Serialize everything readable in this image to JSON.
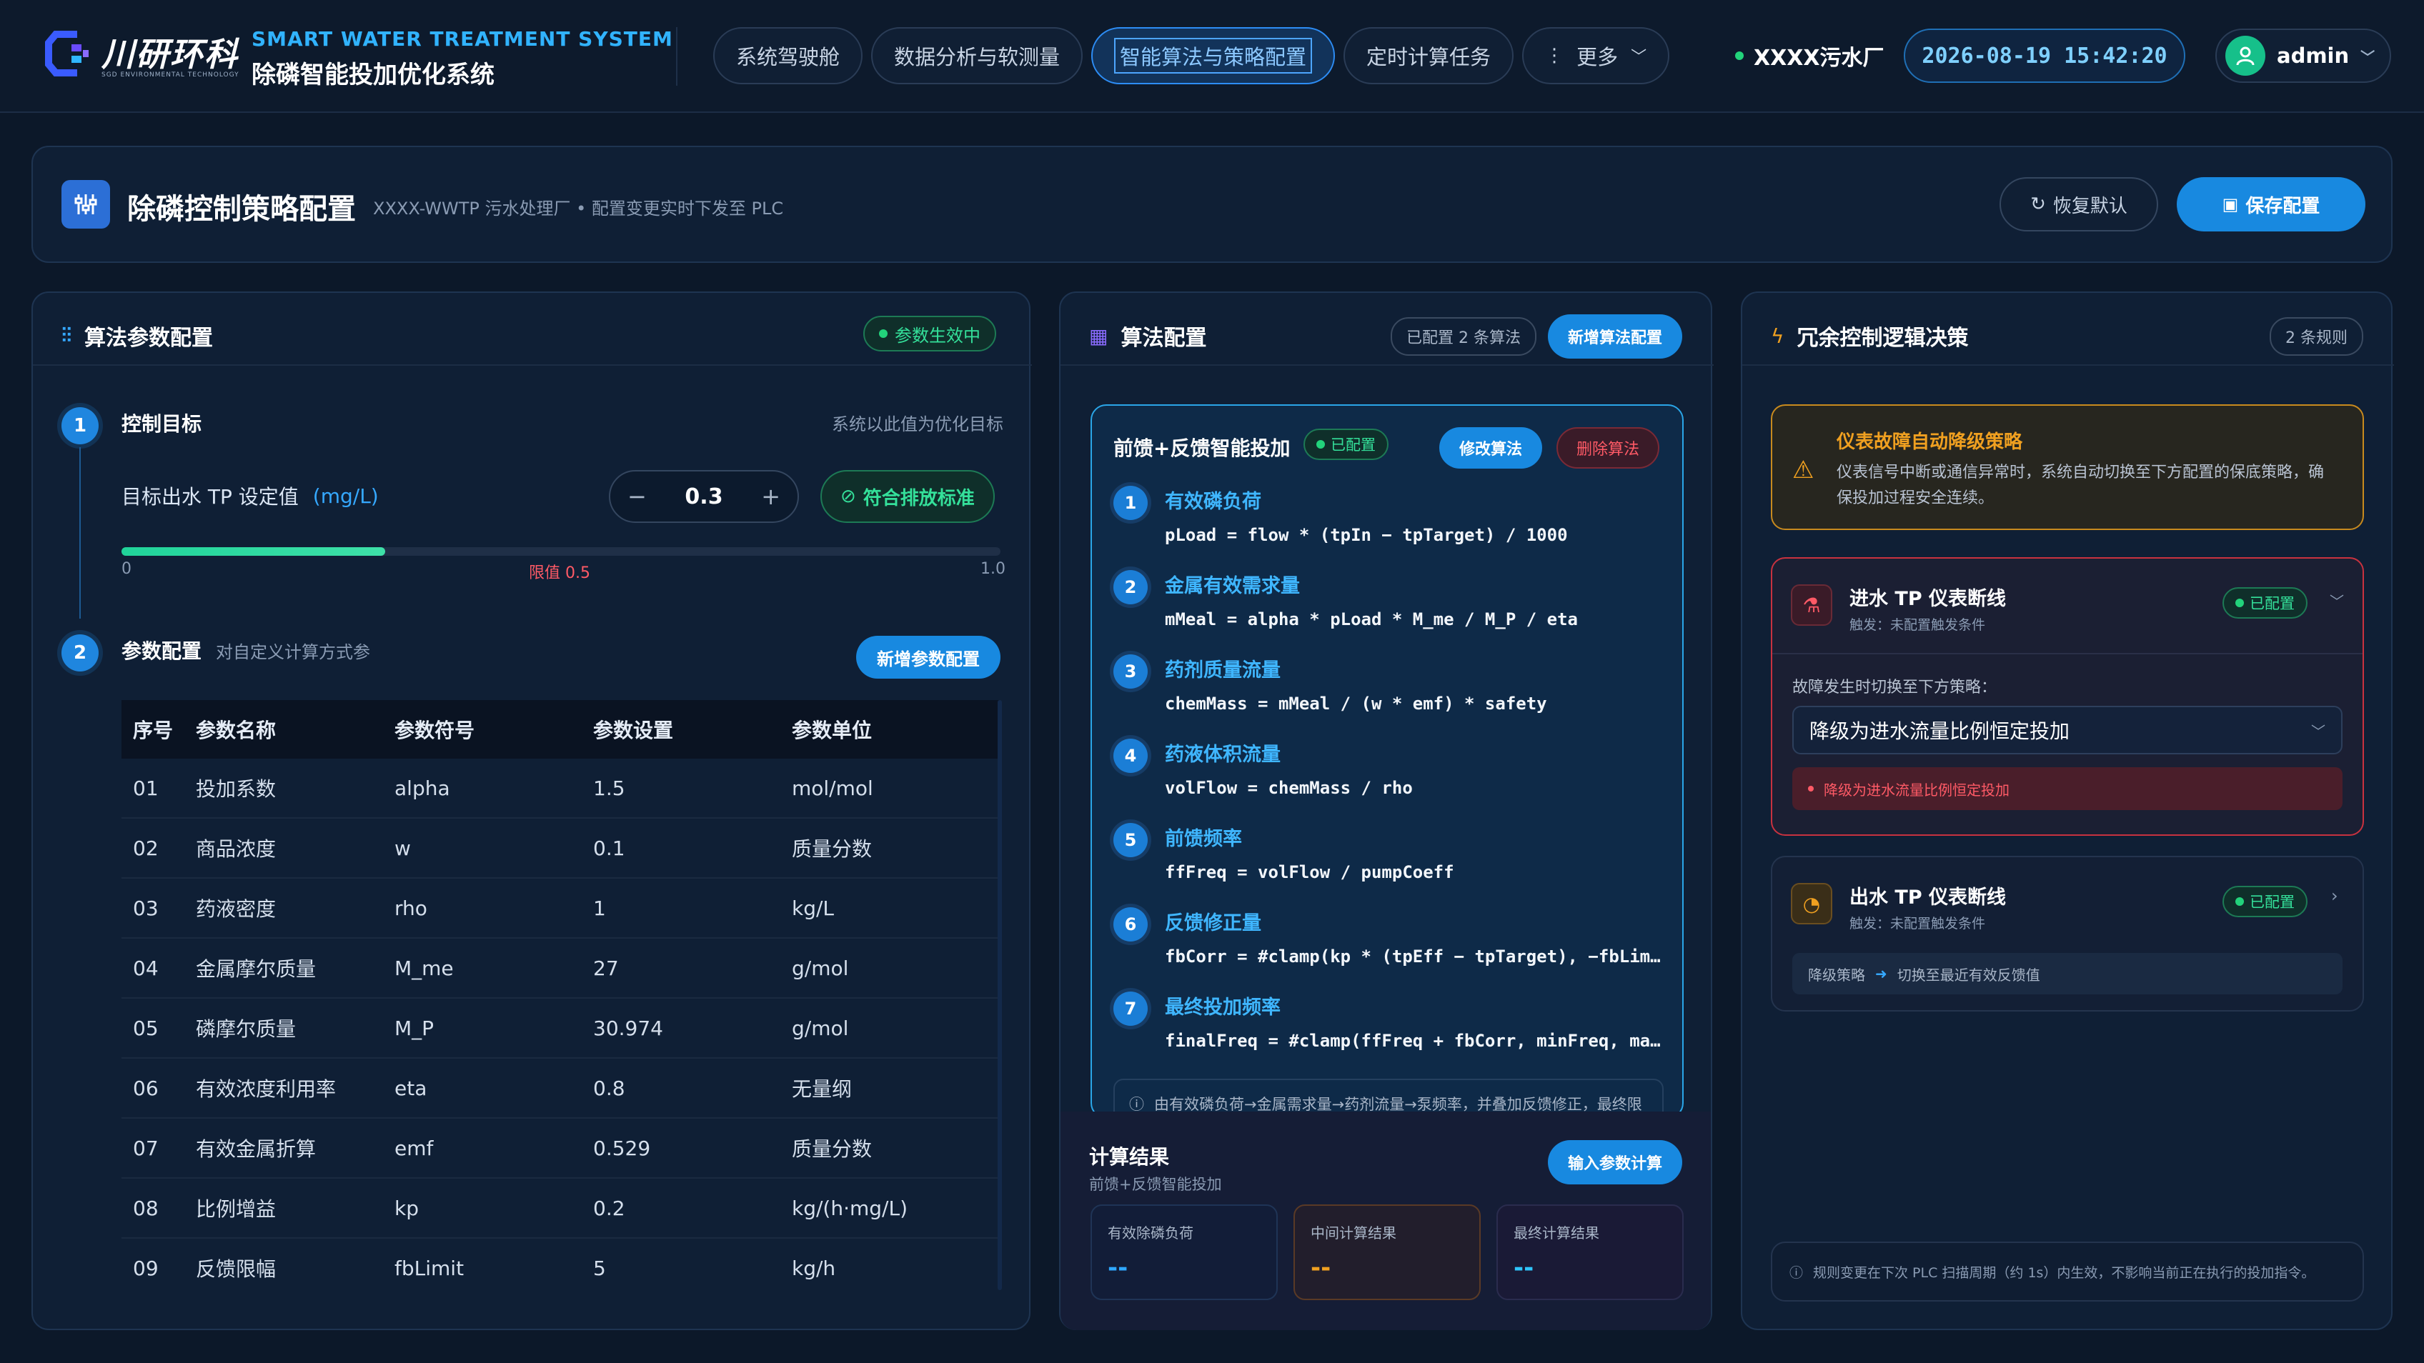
{
  "header": {
    "logo_text": "川研环科",
    "logo_sub": "SGD ENVIRONMENTAL TECHNOLOGY",
    "system_en": "SMART WATER TREATMENT SYSTEM",
    "system_cn": "除磷智能投加优化系统",
    "nav": [
      "系统驾驶舱",
      "数据分析与软测量",
      "智能算法与策略配置",
      "定时计算任务"
    ],
    "more": "更多",
    "plant": "XXXX污水厂",
    "datetime": "2026-08-19 15:42:20",
    "user": "admin"
  },
  "title_card": {
    "title": "除磷控制策略配置",
    "subtitle": "XXXX-WWTP 污水处理厂  •  配置变更实时下发至 PLC",
    "reset_label": "恢复默认",
    "save_label": "保存配置"
  },
  "params_panel": {
    "title": "算法参数配置",
    "status": "参数生效中",
    "step1_title": "控制目标",
    "step1_hint": "系统以此值为优化目标",
    "target_label": "目标出水 TP 设定值",
    "target_unit": "(mg/L)",
    "target_value": "0.3",
    "compliance": "符合排放标准",
    "slider_min": "0",
    "slider_max": "1.0",
    "slider_limit": "限值 0.5",
    "slider_fraction": 0.3,
    "step2_title": "参数配置",
    "step2_hint": "对自定义计算方式参",
    "add_param": "新增参数配置",
    "columns": [
      "序号",
      "参数名称",
      "参数符号",
      "参数设置",
      "参数单位"
    ],
    "rows": [
      [
        "01",
        "投加系数",
        "alpha",
        "1.5",
        "mol/mol"
      ],
      [
        "02",
        "商品浓度",
        "w",
        "0.1",
        "质量分数"
      ],
      [
        "03",
        "药液密度",
        "rho",
        "1",
        "kg/L"
      ],
      [
        "04",
        "金属摩尔质量",
        "M_me",
        "27",
        "g/mol"
      ],
      [
        "05",
        "磷摩尔质量",
        "M_P",
        "30.974",
        "g/mol"
      ],
      [
        "06",
        "有效浓度利用率",
        "eta",
        "0.8",
        "无量纲"
      ],
      [
        "07",
        "有效金属折算",
        "emf",
        "0.529",
        "质量分数"
      ],
      [
        "08",
        "比例增益",
        "kp",
        "0.2",
        "kg/(h·mg/L)"
      ],
      [
        "09",
        "反馈限幅",
        "fbLimit",
        "5",
        "kg/h"
      ]
    ]
  },
  "algo_panel": {
    "title": "算法配置",
    "count": "已配置 2 条算法",
    "add_algo": "新增算法配置",
    "algo_name": "前馈+反馈智能投加",
    "algo_status": "已配置",
    "edit": "修改算法",
    "delete": "删除算法",
    "steps": [
      {
        "title": "有效磷负荷",
        "formula": "pLoad = flow * (tpIn − tpTarget) / 1000"
      },
      {
        "title": "金属有效需求量",
        "formula": "mMeal = alpha * pLoad * M_me / M_P / eta"
      },
      {
        "title": "药剂质量流量",
        "formula": "chemMass = mMeal / (w * emf) * safety"
      },
      {
        "title": "药液体积流量",
        "formula": "volFlow = chemMass / rho"
      },
      {
        "title": "前馈频率",
        "formula": "ffFreq = volFlow / pumpCoeff"
      },
      {
        "title": "反馈修正量",
        "formula": "fbCorr = #clamp(kp * (tpEff − tpTarget), −fbLimit, fbLimit)"
      },
      {
        "title": "最终投加频率",
        "formula": "finalFreq = #clamp(ffFreq + fbCorr, minFreq, maxFreq)"
      }
    ],
    "note": "由有效磷负荷→金属需求量→药剂流量→泵频率，并叠加反馈修正，最终限幅输出。",
    "result_title": "计算结果",
    "result_sub": "前馈+反馈智能投加",
    "result_btn": "输入参数计算",
    "results": [
      {
        "label": "有效除磷负荷",
        "value": "--",
        "color": "#2fa8ff"
      },
      {
        "label": "中间计算结果",
        "value": "--",
        "color": "#f0a020"
      },
      {
        "label": "最终计算结果",
        "value": "--",
        "color": "#2fc6ff"
      }
    ]
  },
  "redundant_panel": {
    "title": "冗余控制逻辑决策",
    "count": "2 条规则",
    "alert_title": "仪表故障自动降级策略",
    "alert_text": "仪表信号中断或通信异常时，系统自动切换至下方配置的保底策略，确保投加过程安全连续。",
    "rule1_title": "进水 TP 仪表断线",
    "rule1_trigger": "触发：未配置触发条件",
    "rule1_status": "已配置",
    "rule1_switch_label": "故障发生时切换至下方策略：",
    "rule1_select": "降级为进水流量比例恒定投加",
    "rule1_error": "降级为进水流量比例恒定投加",
    "rule2_title": "出水 TP 仪表断线",
    "rule2_trigger": "触发：未配置触发条件",
    "rule2_status": "已配置",
    "rule2_strategy_label": "降级策略",
    "rule2_strategy": "切换至最近有效反馈值",
    "footer_note": "规则变更在下次 PLC 扫描周期（约 1s）内生效，不影响当前正在执行的投加指令。"
  }
}
